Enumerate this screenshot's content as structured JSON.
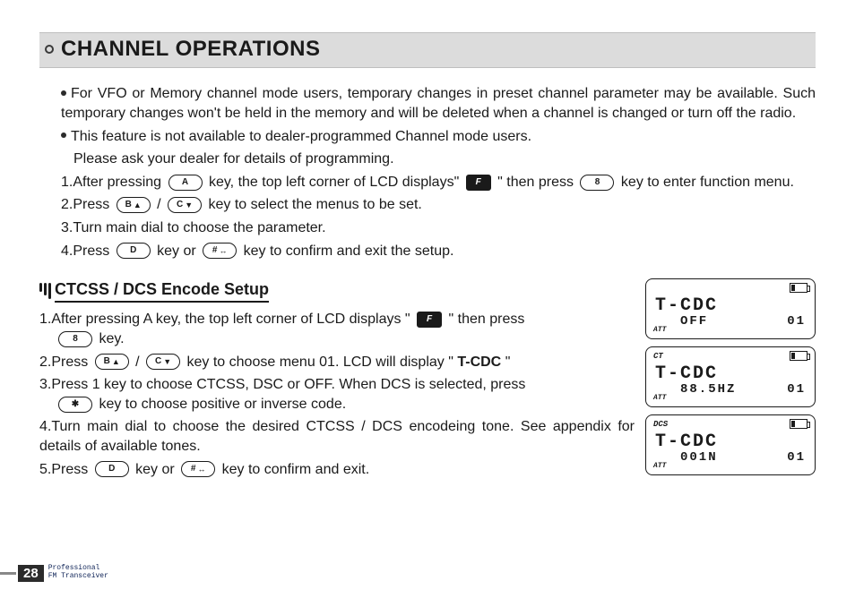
{
  "header": {
    "title": "CHANNEL OPERATIONS"
  },
  "body": {
    "bullets": [
      "For VFO or Memory channel mode users, temporary changes in preset channel parameter may be available. Such  temporary changes won't be held in the memory and will be deleted when a channel is changed or turn off the radio.",
      "This feature is not available to dealer-programmed Channel mode users."
    ],
    "note": "Please ask your dealer for details of programming.",
    "steps": {
      "s1a": "1.After pressing",
      "s1b": "key, the top left corner of LCD displays\"",
      "s1c": "\" then press",
      "s1d": "key to enter function menu.",
      "s2a": "2.Press",
      "s2b": "/",
      "s2c": "key to select the menus to be set.",
      "s3": "3.Turn main dial to choose the parameter.",
      "s4a": "4.Press",
      "s4b": "key or",
      "s4c": "key to confirm and exit the setup."
    }
  },
  "keys": {
    "A": "A",
    "B": "B",
    "C": "C",
    "D": "D",
    "8": "8",
    "star": "✱",
    "hash": "#",
    "F": "F",
    "up": "▲",
    "down": "▼",
    "swap": "↔"
  },
  "section2": {
    "title": "CTCSS / DCS Encode Setup",
    "steps": {
      "s1a": "1.After pressing A key, the top left corner of LCD displays \"",
      "s1b": "\" then press",
      "s1c": "key.",
      "s2a": "2.Press",
      "s2b": "/",
      "s2c": "key to choose menu 01. LCD will display \"",
      "s2d": "T-CDC",
      "s2e": "\"",
      "s3a": "3.Press 1 key to choose CTCSS, DSC or OFF. When DCS is  selected, press",
      "s3b": "key to choose positive or inverse code.",
      "s4": "4.Turn main dial to choose the desired CTCSS / DCS encodeing tone. See appendix for details of available tones.",
      "s5a": "5.Press",
      "s5b": "key or",
      "s5c": "key to confirm and exit."
    }
  },
  "lcd": {
    "main": "T-CDC",
    "att": "ATT",
    "cards": [
      {
        "indicator": "",
        "value": "OFF",
        "menu": "01"
      },
      {
        "indicator": "CT",
        "value": "88.5HZ",
        "menu": "01"
      },
      {
        "indicator": "DCS",
        "value": "001N",
        "menu": "01"
      }
    ]
  },
  "footer": {
    "page": "28",
    "line1": "Professional",
    "line2": "FM Transceiver"
  }
}
